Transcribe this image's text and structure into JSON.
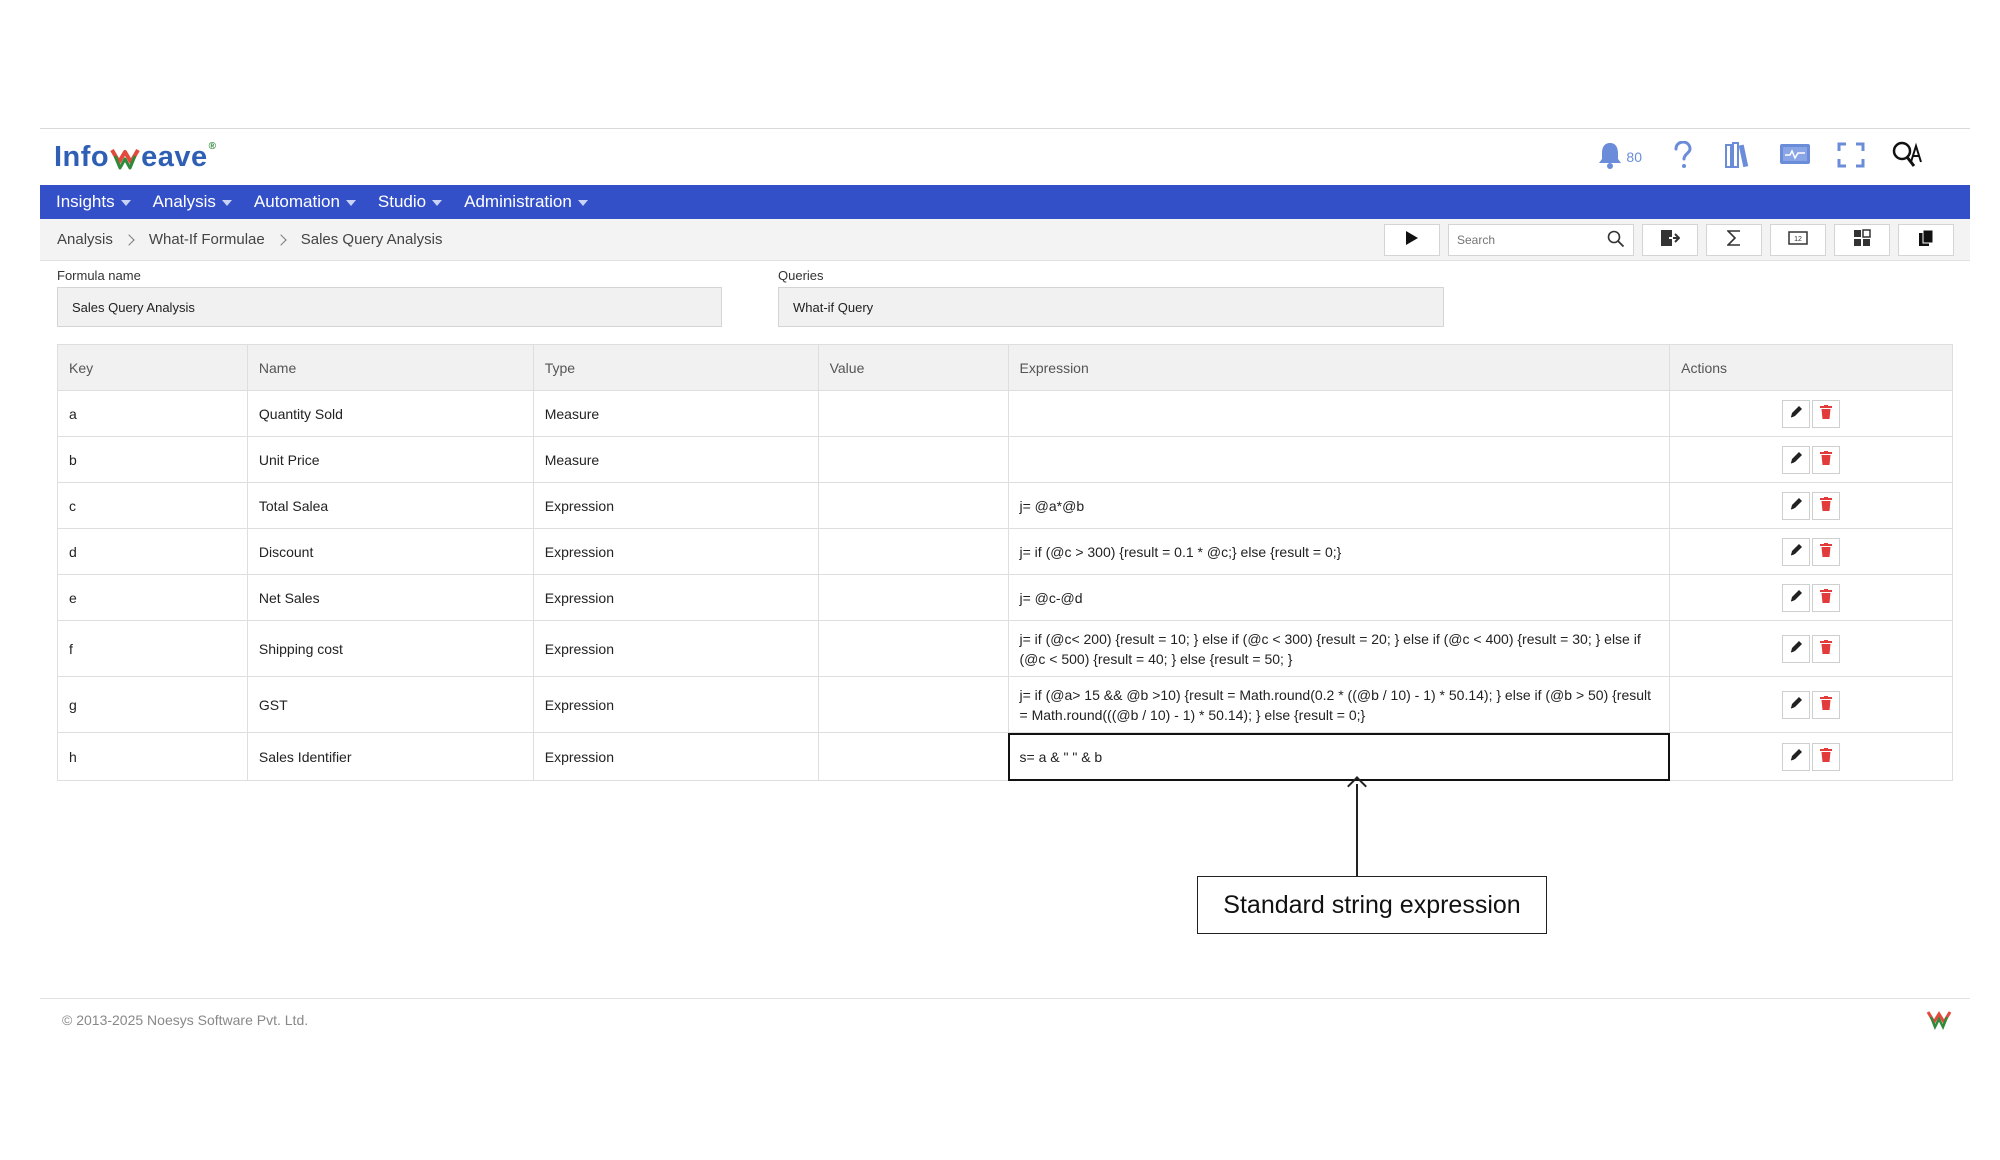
{
  "app": {
    "logo_text_left": "Info",
    "logo_text_right": "eave",
    "notifications_count": "80"
  },
  "nav": {
    "items": [
      "Insights",
      "Analysis",
      "Automation",
      "Studio",
      "Administration"
    ]
  },
  "breadcrumb": [
    "Analysis",
    "What-If Formulae",
    "Sales Query Analysis"
  ],
  "toolbar": {
    "search_placeholder": "Search"
  },
  "form": {
    "formula_name_label": "Formula name",
    "formula_name_value": "Sales Query Analysis",
    "queries_label": "Queries",
    "queries_value": "What-if Query"
  },
  "table": {
    "headers": [
      "Key",
      "Name",
      "Type",
      "Value",
      "Expression",
      "Actions"
    ],
    "rows": [
      {
        "key": "a",
        "name": "Quantity Sold",
        "type": "Measure",
        "value": "",
        "expression": ""
      },
      {
        "key": "b",
        "name": "Unit Price",
        "type": "Measure",
        "value": "",
        "expression": ""
      },
      {
        "key": "c",
        "name": "Total Salea",
        "type": "Expression",
        "value": "",
        "expression": "j= @a*@b"
      },
      {
        "key": "d",
        "name": "Discount",
        "type": "Expression",
        "value": "",
        "expression": "j= if (@c > 300) {result = 0.1 * @c;} else {result = 0;}"
      },
      {
        "key": "e",
        "name": "Net Sales",
        "type": "Expression",
        "value": "",
        "expression": "j= @c-@d"
      },
      {
        "key": "f",
        "name": "Shipping cost",
        "type": "Expression",
        "value": "",
        "expression": "j= if (@c< 200) {result = 10; } else if (@c < 300) {result = 20; } else if (@c < 400) {result = 30; } else if (@c < 500) {result = 40; } else {result = 50; }"
      },
      {
        "key": "g",
        "name": "GST",
        "type": "Expression",
        "value": "",
        "expression": "j= if (@a> 15 && @b >10) {result = Math.round(0.2 * ((@b / 10) - 1) * 50.14); } else if (@b > 50) {result = Math.round(((@b / 10) - 1) * 50.14); } else {result = 0;}"
      },
      {
        "key": "h",
        "name": "Sales Identifier",
        "type": "Expression",
        "value": "",
        "expression": "s= a & \" \" & b"
      }
    ]
  },
  "annotation": {
    "callout_text": "Standard string expression"
  },
  "footer": {
    "copyright": "© 2013-2025 Noesys Software Pvt. Ltd."
  },
  "colors": {
    "nav_bg": "#3350c8",
    "logo_blue": "#2f5fb5",
    "delete_red": "#e23b3b",
    "icon_blue": "#6b8cd9"
  }
}
